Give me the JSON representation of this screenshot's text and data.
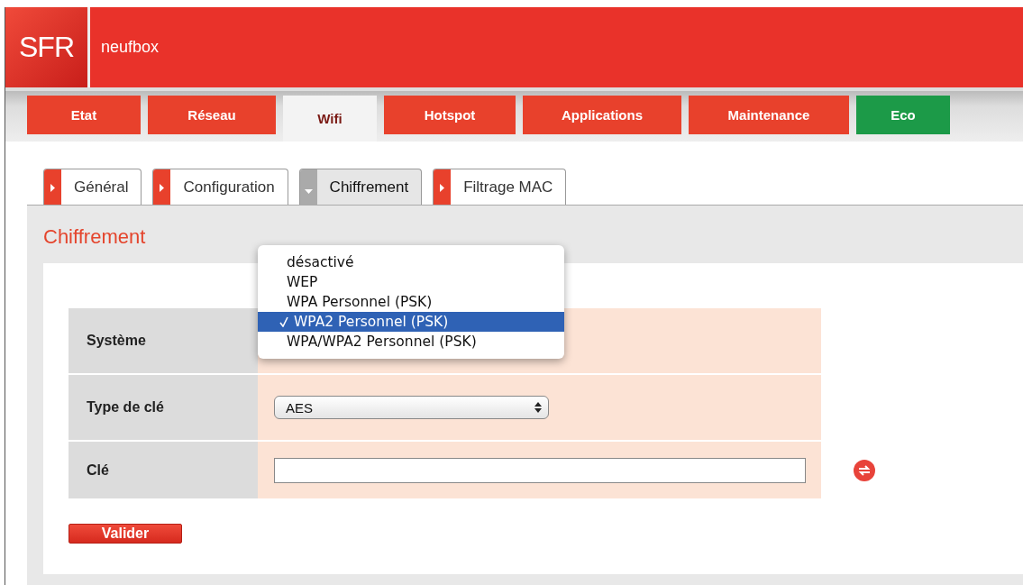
{
  "header": {
    "logo": "SFR",
    "product": "neufbox"
  },
  "nav_tabs": [
    {
      "label": "Etat",
      "selected": false,
      "color": "#e8412c"
    },
    {
      "label": "Réseau",
      "selected": false,
      "color": "#e8412c"
    },
    {
      "label": "Wifi",
      "selected": true,
      "color": "#f3f3f3"
    },
    {
      "label": "Hotspot",
      "selected": false,
      "color": "#e8412c"
    },
    {
      "label": "Applications",
      "selected": false,
      "color": "#e8412c"
    },
    {
      "label": "Maintenance",
      "selected": false,
      "color": "#e8412c"
    },
    {
      "label": "Eco",
      "selected": false,
      "color": "#1c9a48"
    }
  ],
  "sub_tabs": [
    {
      "label": "Général",
      "selected": false
    },
    {
      "label": "Configuration",
      "selected": false
    },
    {
      "label": "Chiffrement",
      "selected": true
    },
    {
      "label": "Filtrage MAC",
      "selected": false
    }
  ],
  "section_title": "Chiffrement",
  "form_rows": [
    {
      "label": "Système",
      "kind": "select-open",
      "options": [
        {
          "label": "désactivé",
          "selected": false
        },
        {
          "label": "WEP",
          "selected": false
        },
        {
          "label": "WPA Personnel (PSK)",
          "selected": false
        },
        {
          "label": "WPA2 Personnel (PSK)",
          "selected": true
        },
        {
          "label": "WPA/WPA2 Personnel (PSK)",
          "selected": false
        }
      ]
    },
    {
      "label": "Type de clé",
      "kind": "select",
      "value": "AES"
    },
    {
      "label": "Clé",
      "kind": "text"
    }
  ],
  "submit_button": "Valider"
}
